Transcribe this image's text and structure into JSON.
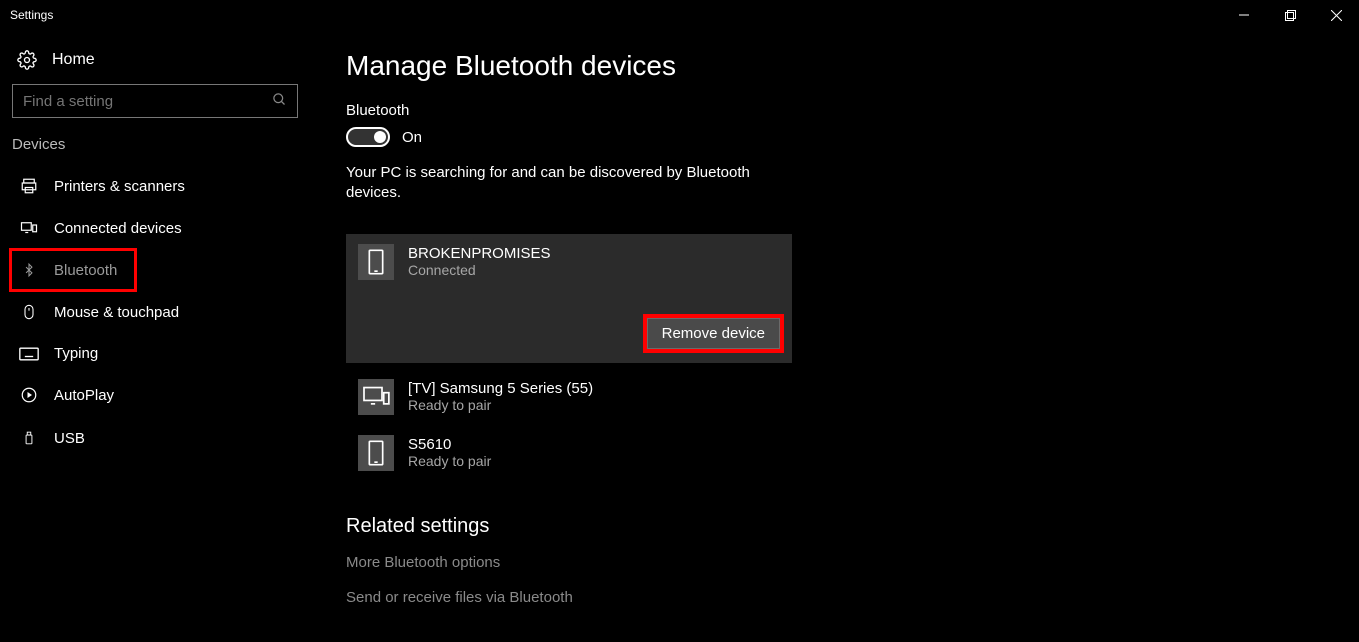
{
  "window": {
    "title": "Settings"
  },
  "sidebar": {
    "home_label": "Home",
    "search_placeholder": "Find a setting",
    "section_label": "Devices",
    "items": [
      {
        "label": "Printers & scanners"
      },
      {
        "label": "Connected devices"
      },
      {
        "label": "Bluetooth"
      },
      {
        "label": "Mouse & touchpad"
      },
      {
        "label": "Typing"
      },
      {
        "label": "AutoPlay"
      },
      {
        "label": "USB"
      }
    ]
  },
  "main": {
    "heading": "Manage Bluetooth devices",
    "toggle_label": "Bluetooth",
    "toggle_state": "On",
    "status_text": "Your PC is searching for and can be discovered by Bluetooth devices.",
    "devices": [
      {
        "name": "BROKENPROMISES",
        "status": "Connected",
        "action": "Remove device"
      },
      {
        "name": "[TV] Samsung 5 Series (55)",
        "status": "Ready to pair"
      },
      {
        "name": "S5610",
        "status": "Ready to pair"
      }
    ],
    "related_heading": "Related settings",
    "related_links": [
      "More Bluetooth options",
      "Send or receive files via Bluetooth"
    ]
  }
}
